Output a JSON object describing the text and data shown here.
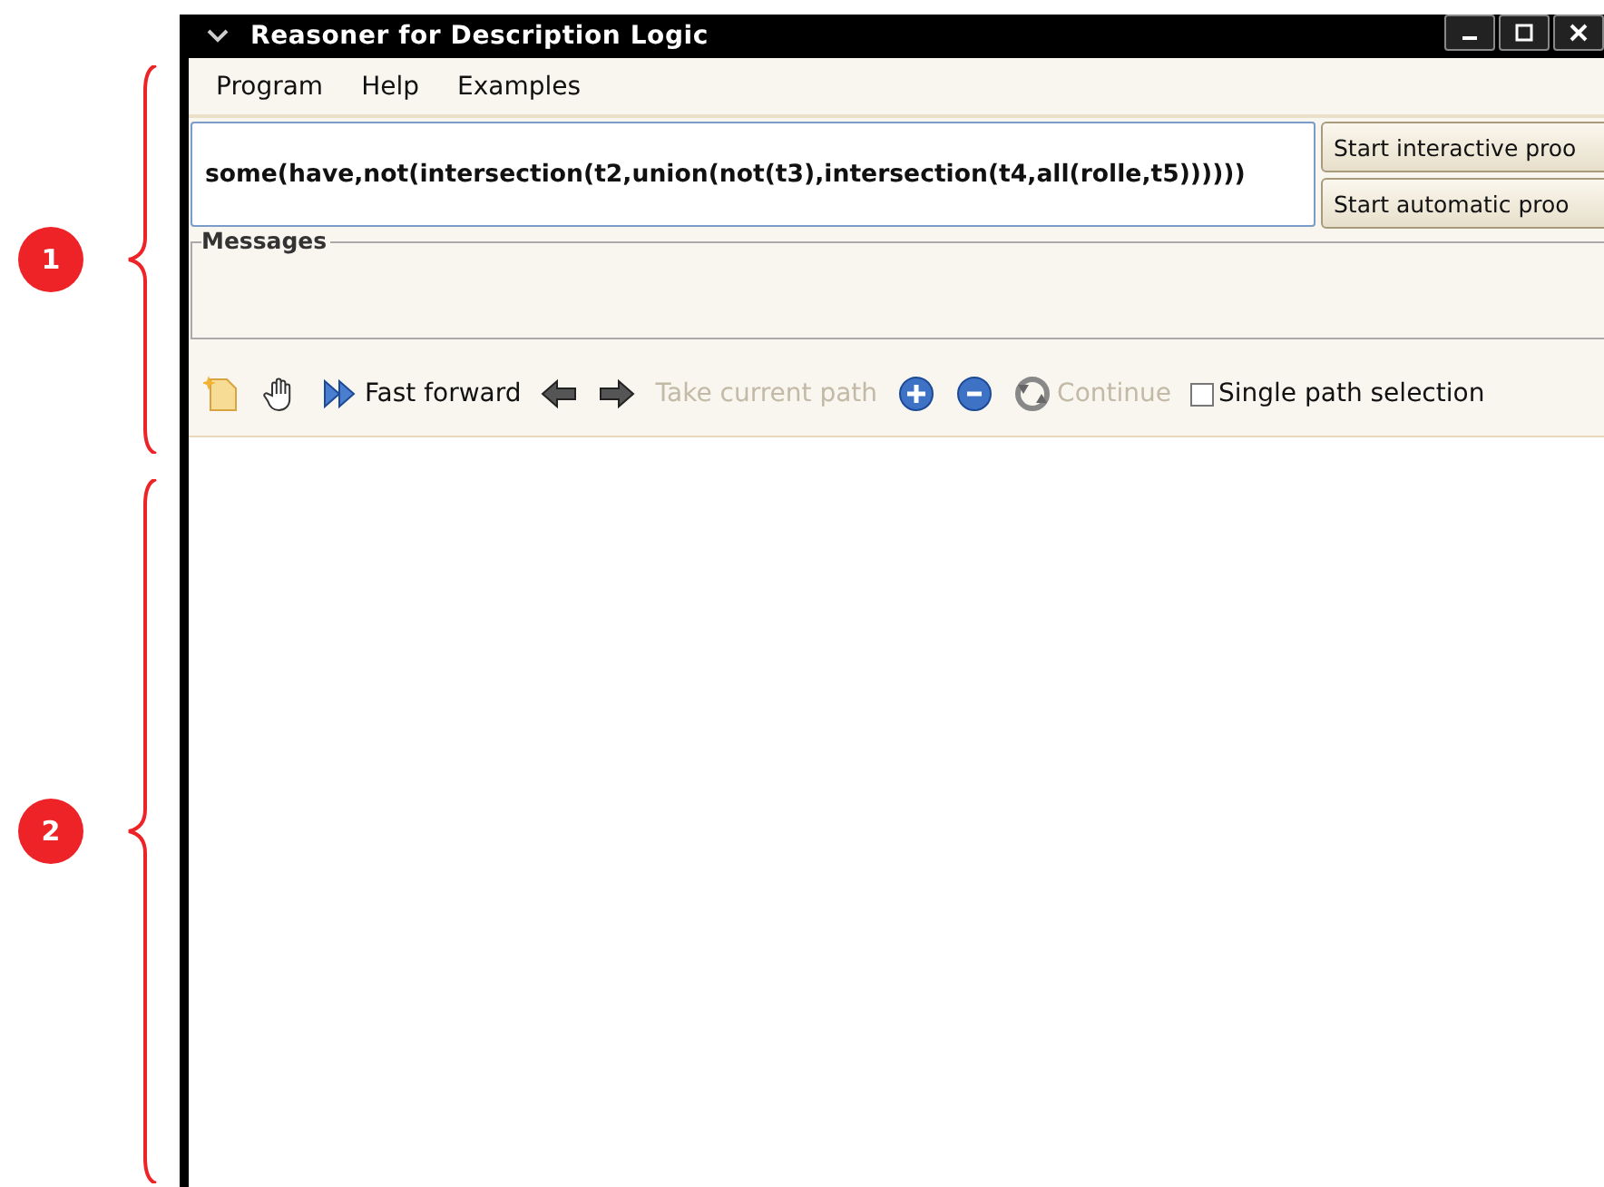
{
  "annotations": [
    {
      "number": "1"
    },
    {
      "number": "2"
    }
  ],
  "window": {
    "title": "Reasoner for Description Logic"
  },
  "menu": [
    "Program",
    "Help",
    "Examples"
  ],
  "formula": {
    "value": "some(have,not(intersection(t2,union(not(t3),intersection(t4,all(rolle,t5))))))"
  },
  "buttons": [
    "Start interactive proo",
    "Start automatic proo"
  ],
  "messages": {
    "label": "Messages"
  },
  "toolbar": [
    {
      "kind": "new"
    },
    {
      "kind": "pan"
    },
    {
      "kind": "fast-forward",
      "label": "Fast forward",
      "disabled": false
    },
    {
      "kind": "back"
    },
    {
      "kind": "forward"
    },
    {
      "kind": "text",
      "label": "Take current path",
      "disabled": true
    },
    {
      "kind": "expand"
    },
    {
      "kind": "collapse"
    },
    {
      "kind": "continue",
      "label": "Continue",
      "disabled": true
    },
    {
      "kind": "checkbox",
      "label": "Single path selection",
      "checked": false
    }
  ]
}
